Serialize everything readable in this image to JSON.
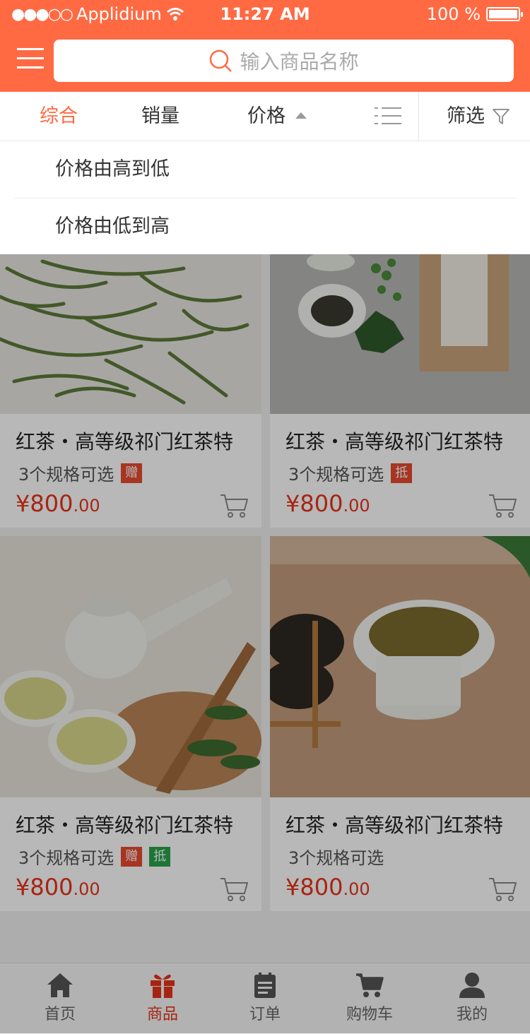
{
  "status_bar": {
    "carrier": "Applidium",
    "time": "11:27 AM",
    "battery": "100 %"
  },
  "header": {
    "search_placeholder": "输入商品名称"
  },
  "sort_tabs": {
    "comprehensive": "综合",
    "sales": "销量",
    "price": "价格",
    "filter": "筛选"
  },
  "price_menu": {
    "high_to_low": "价格由高到低",
    "low_to_high": "价格由低到高"
  },
  "products": [
    {
      "title": "红茶・高等级祁门红茶特",
      "spec": "3个规格可选",
      "badges": [
        "赠"
      ],
      "price_int": "¥800",
      "price_dec": ".00"
    },
    {
      "title": "红茶・高等级祁门红茶特",
      "spec": "3个规格可选",
      "badges": [
        "抵"
      ],
      "price_int": "¥800",
      "price_dec": ".00"
    },
    {
      "title": "红茶・高等级祁门红茶特",
      "spec": "3个规格可选",
      "badges": [
        "赠",
        "抵"
      ],
      "price_int": "¥800",
      "price_dec": ".00"
    },
    {
      "title": "红茶・高等级祁门红茶特",
      "spec": "3个规格可选",
      "badges": [],
      "price_int": "¥800",
      "price_dec": ".00"
    }
  ],
  "tabbar": {
    "home": "首页",
    "products": "商品",
    "orders": "订单",
    "cart": "购物车",
    "mine": "我的"
  },
  "colors": {
    "accent": "#ff6a43",
    "price": "#e8321a",
    "badge_gift": "#e84a2e",
    "badge_deduct": "#2aa44a"
  }
}
